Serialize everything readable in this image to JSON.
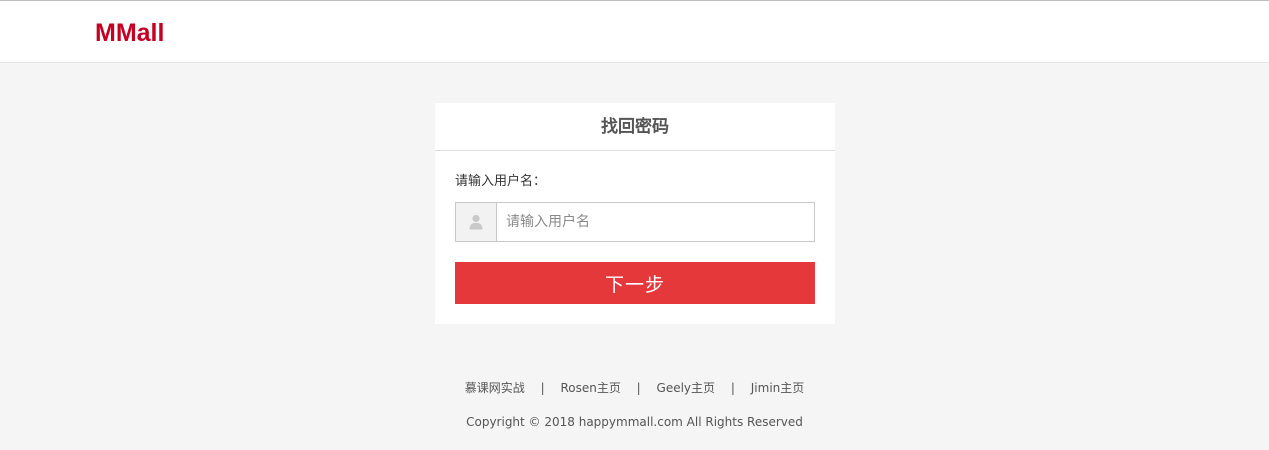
{
  "header": {
    "logo": "MMall",
    "brand_color": "#c60023"
  },
  "panel": {
    "title": "找回密码",
    "username_label": "请输入用户名：",
    "username_placeholder": "请输入用户名",
    "username_value": "",
    "user_icon": "user-icon",
    "next_button": "下一步",
    "button_color": "#e5383b"
  },
  "footer": {
    "links": [
      "慕课网实战",
      "Rosen主页",
      "Geely主页",
      "Jimin主页"
    ],
    "separator": "|",
    "copyright": "Copyright © 2018 happymmall.com All Rights Reserved"
  }
}
